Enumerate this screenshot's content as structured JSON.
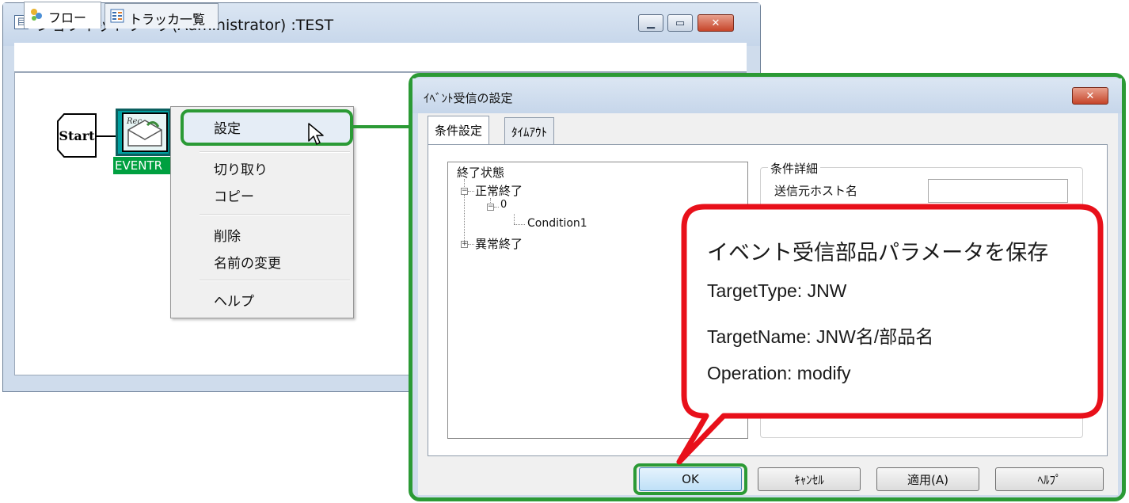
{
  "main_window": {
    "title": "ジョブネットワーク(Administrator) :TEST",
    "app_icon": "jobnet-icon",
    "minimize_glyph": "▁",
    "maximize_glyph": "▭",
    "close_glyph": "✕",
    "tabs": [
      {
        "label": "フロー",
        "icon": "flow-icon",
        "active": true
      },
      {
        "label": "トラッカ一覧",
        "icon": "tracker-icon",
        "active": false
      }
    ]
  },
  "flow": {
    "start_label": "Start",
    "event_label": "EVENTR"
  },
  "context_menu": {
    "items": [
      {
        "label": "設定",
        "highlighted": true
      },
      {
        "label": "切り取り"
      },
      {
        "label": "コピー"
      },
      {
        "label": "削除"
      },
      {
        "label": "名前の変更"
      },
      {
        "label": "ヘルプ"
      }
    ]
  },
  "dialog": {
    "title": "ｲﾍﾞﾝﾄ受信の設定",
    "close_glyph": "✕",
    "tabs": [
      {
        "label": "条件設定",
        "active": true
      },
      {
        "label": "ﾀｲﾑｱｳﾄ",
        "active": false
      }
    ],
    "tree": {
      "root": "終了状態",
      "normal": "正常終了",
      "code": "0",
      "condition": "Condition1",
      "abnormal": "異常終了",
      "collapse_glyph": "−",
      "expand_glyph": "+"
    },
    "details": {
      "legend": "条件詳細",
      "sender_host_label": "送信元ホスト名",
      "sender_host_value": ""
    },
    "buttons": {
      "ok": "OK",
      "cancel": "ｷｬﾝｾﾙ",
      "apply": "適用(A)",
      "help": "ﾍﾙﾌﾟ"
    }
  },
  "callout": {
    "lines": [
      "イベント受信部品パラメータを保存",
      "TargetType: JNW",
      "TargetName: JNW名/部品名",
      "Operation: modify"
    ]
  },
  "colors": {
    "highlight_green": "#2b9a35",
    "callout_red": "#e8101a",
    "node_teal": "#00a0a0"
  }
}
